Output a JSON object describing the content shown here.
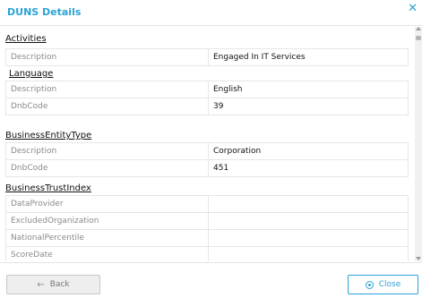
{
  "header": {
    "title": "DUNS Details",
    "close_icon": "close-icon"
  },
  "sections": {
    "activities": {
      "title": "Activities",
      "rows": [
        {
          "key": "Description",
          "value": "Engaged In IT Services"
        }
      ]
    },
    "language": {
      "title": "Language",
      "rows": [
        {
          "key": "Description",
          "value": "English"
        },
        {
          "key": "DnbCode",
          "value": "39"
        }
      ]
    },
    "business_entity_type": {
      "title": "BusinessEntityType",
      "rows": [
        {
          "key": "Description",
          "value": "Corporation"
        },
        {
          "key": "DnbCode",
          "value": "451"
        }
      ]
    },
    "business_trust_index": {
      "title": "BusinessTrustIndex",
      "rows": [
        {
          "key": "DataProvider",
          "value": ""
        },
        {
          "key": "ExcludedOrganization",
          "value": ""
        },
        {
          "key": "NationalPercentile",
          "value": ""
        },
        {
          "key": "ScoreDate",
          "value": ""
        }
      ]
    }
  },
  "footer": {
    "back_label": "Back",
    "close_label": "Close"
  },
  "colors": {
    "accent": "#2aa3d6",
    "label_gray": "#8a8a8a",
    "border": "#e6e6e6"
  }
}
